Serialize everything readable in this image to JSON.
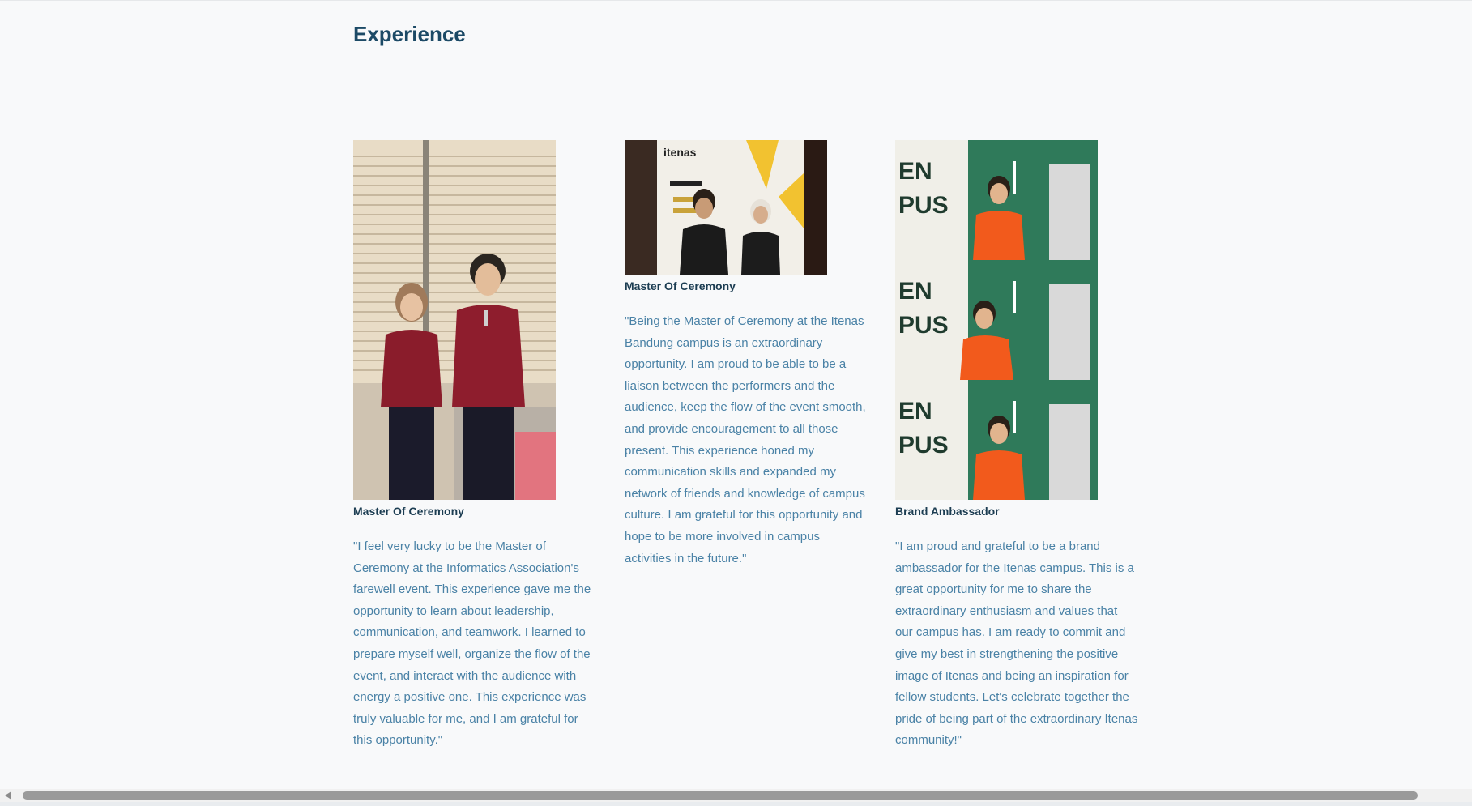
{
  "section": {
    "title": "Experience"
  },
  "cards": [
    {
      "role": "Master Of Ceremony",
      "quote": "\"I feel very lucky to be the Master of Ceremony at the Informatics Association's farewell event. This experience gave me the opportunity to learn about leadership, communication, and teamwork. I learned to prepare myself well, organize the flow of the event, and interact with the audience with energy a positive one. This experience was truly valuable for me, and I am grateful for this opportunity.\""
    },
    {
      "role": "Master Of Ceremony",
      "quote": "\"Being the Master of Ceremony at the Itenas Bandung campus is an extraordinary opportunity. I am proud to be able to be a liaison between the performers and the audience, keep the flow of the event smooth, and provide encouragement to all those present. This experience honed my communication skills and expanded my network of friends and knowledge of campus culture. I am grateful for this opportunity and hope to be more involved in campus activities in the future.\"",
      "banner_text": "itenas"
    },
    {
      "role": "Brand Ambassador",
      "quote": "\"I am proud and grateful to be a brand ambassador for the Itenas campus. This is a great opportunity for me to share the extraordinary enthusiasm and values that our campus has. I am ready to commit and give my best in strengthening the positive image of Itenas and being an inspiration for fellow students. Let's celebrate together the pride of being part of the extraordinary Itenas community!\""
    }
  ]
}
